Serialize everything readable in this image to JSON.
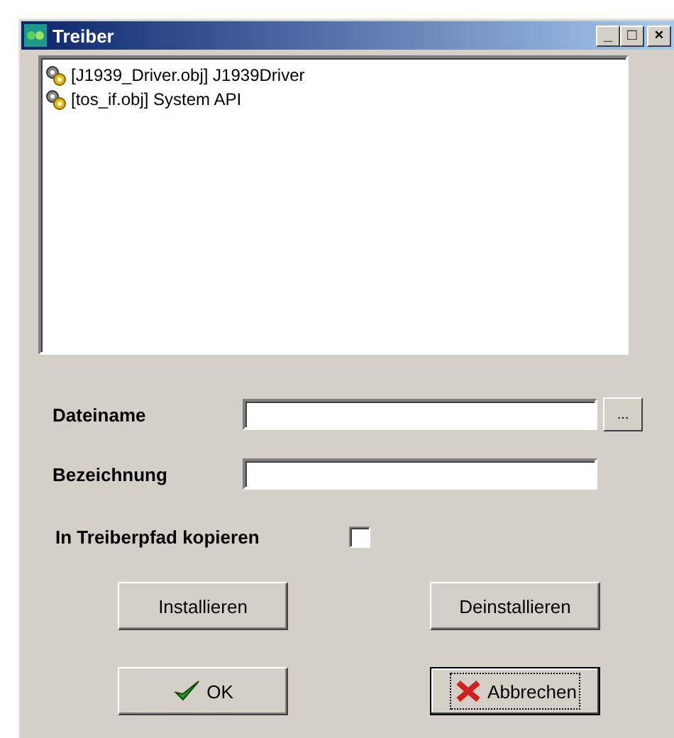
{
  "window": {
    "title": "Treiber",
    "controls": [
      "_",
      "□",
      "×"
    ]
  },
  "drivers": [
    {
      "label": "[J1939_Driver.obj] J1939Driver"
    },
    {
      "label": "[tos_if.obj] System API"
    }
  ],
  "fields": [
    {
      "label": "Dateiname",
      "browse": "..."
    },
    {
      "label": "Bezeichnung"
    }
  ],
  "copy_option": {
    "label": "In Treiberpfad kopieren",
    "checked": false
  },
  "buttons": [
    {
      "label": "Installieren",
      "kind": "plain",
      "focused": false
    },
    {
      "label": "Deinstallieren",
      "kind": "plain",
      "focused": false
    },
    {
      "label": "OK",
      "kind": "check",
      "focused": false
    },
    {
      "label": "Abbrechen",
      "kind": "cross",
      "focused": true
    }
  ]
}
